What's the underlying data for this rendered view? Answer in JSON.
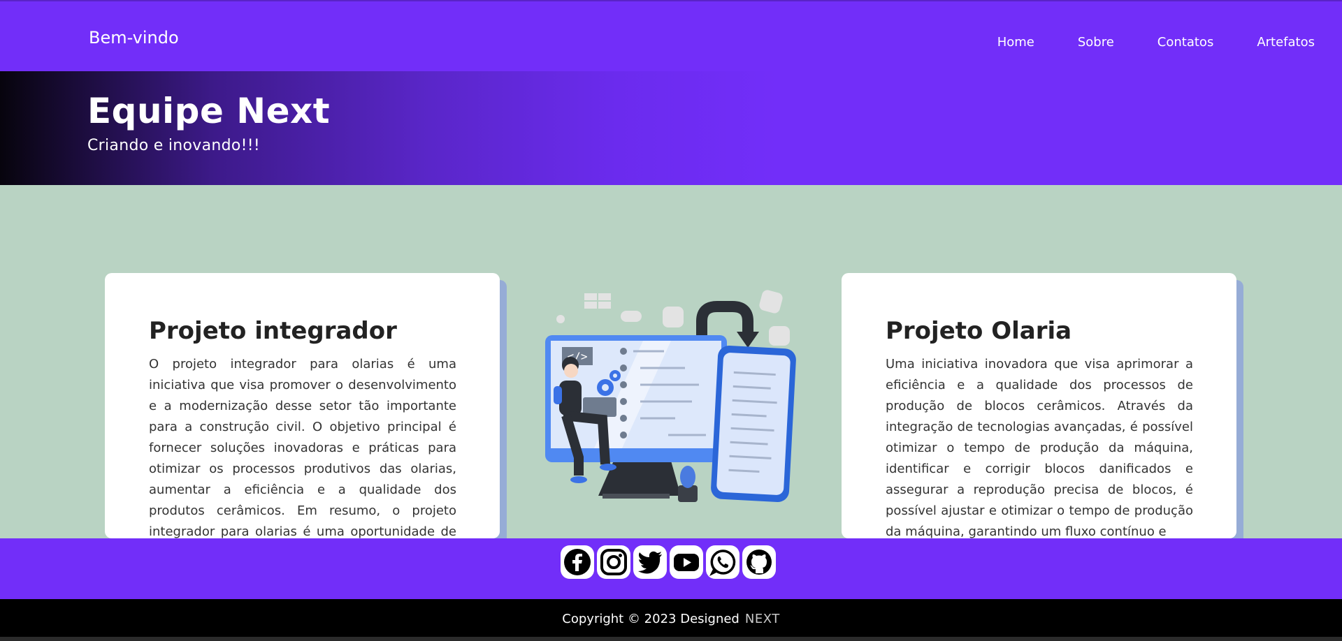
{
  "nav": {
    "brand": "Bem-vindo",
    "links": [
      "Home",
      "Sobre",
      "Contatos",
      "Artefatos"
    ]
  },
  "hero": {
    "title": "Equipe Next",
    "subtitle": "Criando e inovando!!!"
  },
  "cards": [
    {
      "title": "Projeto integrador",
      "text": "O projeto integrador para olarias é uma iniciativa que visa promover o desenvolvimento e a modernização desse setor tão importante para a construção civil. O objetivo principal é fornecer soluções inovadoras e práticas para otimizar os processos produtivos das olarias, aumentar a eficiência e a qualidade dos produtos cerâmicos. Em resumo, o projeto integrador para olarias é uma oportunidade de modernização e"
    },
    {
      "title": "Projeto Olaria",
      "text": "Uma iniciativa inovadora que visa aprimorar a eficiência e a qualidade dos processos de produção de blocos cerâmicos. Através da integração de tecnologias avançadas, é possível otimizar o tempo de produção da máquina, identificar e corrigir blocos danificados e assegurar a reprodução precisa de blocos, é possível ajustar e otimizar o tempo de produção da máquina, garantindo um fluxo contínuo e"
    }
  ],
  "illustration": {
    "icon": "developer-illustration",
    "code_tag": "</>"
  },
  "social": [
    "facebook-icon",
    "instagram-icon",
    "twitter-icon",
    "youtube-icon",
    "whatsapp-icon",
    "github-icon"
  ],
  "footer": {
    "copyright": "Copyright © 2023 Designed",
    "brand": "NEXT"
  },
  "colors": {
    "primary": "#722ef9",
    "background": "#b9d3c3",
    "card_shadow": "#96acd6",
    "footer": "#000000"
  }
}
